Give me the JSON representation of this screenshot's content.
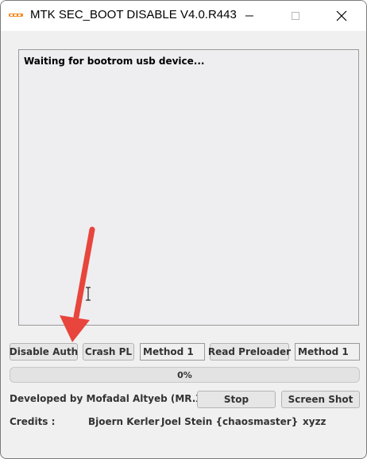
{
  "window": {
    "title": "MTK SEC_BOOT DISABLE V4.0.R443",
    "app_icon": "mediatek-logo-icon",
    "controls": [
      "minimize-icon",
      "maximize-icon",
      "close-icon"
    ]
  },
  "log": {
    "text": "Waiting for bootrom usb device..."
  },
  "buttons_row": {
    "disable_auth": "Disable Auth",
    "crash_pl": "Crash PL",
    "method_1_a": "Method 1",
    "read_preloader": "Read Preloader",
    "method_1_b": "Method 1"
  },
  "progress": {
    "value": 0,
    "label": "0%"
  },
  "footer": {
    "developer": "Developed by Mofadal Altyeb (MR.X)",
    "stop": "Stop",
    "screen_shot": "Screen Shot",
    "credits_label": "Credits :",
    "credit_1": "Bjoern Kerler",
    "credit_2": "Joel Stein {chaosmaster}",
    "credit_3": "xyzz"
  },
  "colors": {
    "arrow": "#e8453c",
    "progress_fill": "#3aa55d",
    "logo_orange": "#f28c28"
  }
}
